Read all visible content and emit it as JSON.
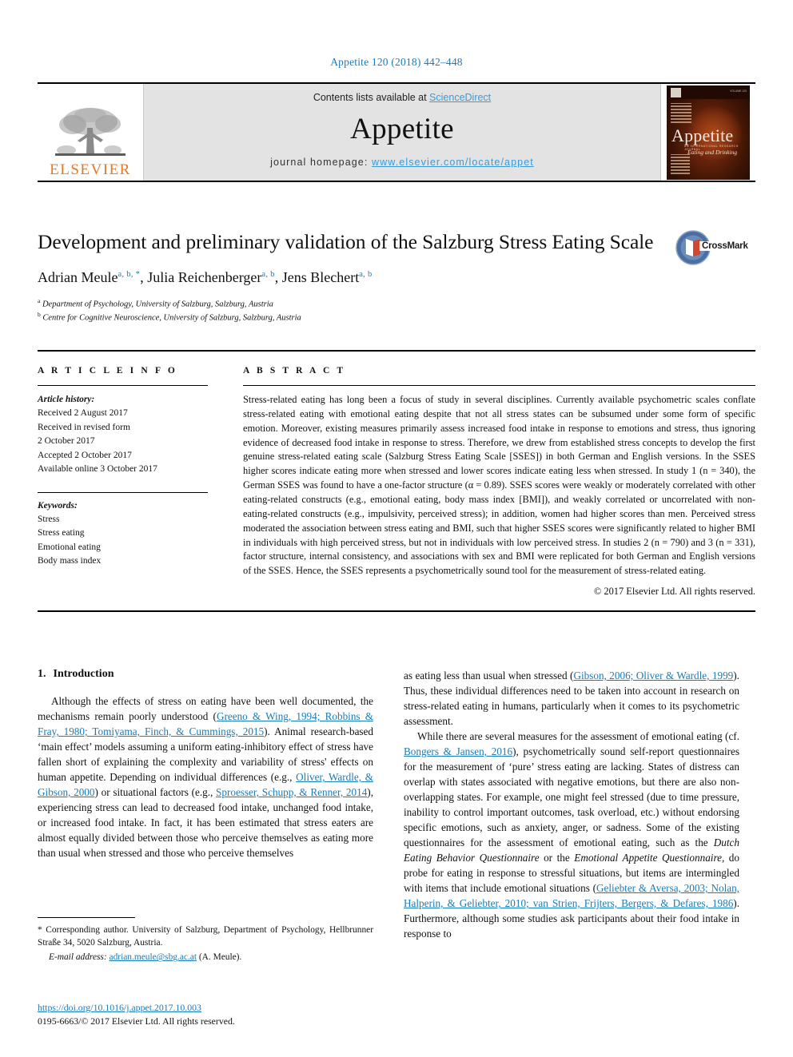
{
  "running_head": "Appetite 120 (2018) 442–448",
  "masthead": {
    "contents_prefix": "Contents lists available at ",
    "sciencedirect": "ScienceDirect",
    "journal_title": "Appetite",
    "homepage_prefix": "journal homepage: ",
    "homepage_url": "www.elsevier.com/locate/appet",
    "publisher_name": "ELSEVIER",
    "publisher_logo_icon": "elsevier-tree-logo",
    "cover": {
      "journal_name": "Appetite",
      "subtitle_small": "AN INTERNATIONAL RESEARCH JOURNAL",
      "subtitle_italic": "Eating and Drinking",
      "issue_text": "VOLUME 120"
    }
  },
  "article": {
    "title": "Development and preliminary validation of the Salzburg Stress Eating Scale",
    "authors": [
      {
        "name": "Adrian Meule",
        "marks": "a, b, *"
      },
      {
        "name": "Julia Reichenberger",
        "marks": "a, b"
      },
      {
        "name": "Jens Blechert",
        "marks": "a, b"
      }
    ],
    "affiliations": [
      {
        "mark": "a",
        "text": "Department of Psychology, University of Salzburg, Salzburg, Austria"
      },
      {
        "mark": "b",
        "text": "Centre for Cognitive Neuroscience, University of Salzburg, Salzburg, Austria"
      }
    ],
    "crossmark_label": "CrossMark",
    "crossmark_icon": "crossmark-badge-icon"
  },
  "article_info": {
    "heading": "A R T I C L E  I N F O",
    "history_label": "Article history:",
    "history_lines": [
      "Received 2 August 2017",
      "Received in revised form",
      "2 October 2017",
      "Accepted 2 October 2017",
      "Available online 3 October 2017"
    ],
    "keywords_label": "Keywords:",
    "keywords": [
      "Stress",
      "Stress eating",
      "Emotional eating",
      "Body mass index"
    ]
  },
  "abstract": {
    "heading": "A B S T R A C T",
    "text": "Stress-related eating has long been a focus of study in several disciplines. Currently available psychometric scales conflate stress-related eating with emotional eating despite that not all stress states can be subsumed under some form of specific emotion. Moreover, existing measures primarily assess increased food intake in response to emotions and stress, thus ignoring evidence of decreased food intake in response to stress. Therefore, we drew from established stress concepts to develop the first genuine stress-related eating scale (Salzburg Stress Eating Scale [SSES]) in both German and English versions. In the SSES higher scores indicate eating more when stressed and lower scores indicate eating less when stressed. In study 1 (n = 340), the German SSES was found to have a one-factor structure (α = 0.89). SSES scores were weakly or moderately correlated with other eating-related constructs (e.g., emotional eating, body mass index [BMI]), and weakly correlated or uncorrelated with non-eating-related constructs (e.g., impulsivity, perceived stress); in addition, women had higher scores than men. Perceived stress moderated the association between stress eating and BMI, such that higher SSES scores were significantly related to higher BMI in individuals with high perceived stress, but not in individuals with low perceived stress. In studies 2 (n = 790) and 3 (n = 331), factor structure, internal consistency, and associations with sex and BMI were replicated for both German and English versions of the SSES. Hence, the SSES represents a psychometrically sound tool for the measurement of stress-related eating.",
    "copyright": "© 2017 Elsevier Ltd. All rights reserved."
  },
  "introduction": {
    "number": "1.",
    "heading": "Introduction",
    "left_paragraph_1_a": "Although the effects of stress on eating have been well documented, the mechanisms remain poorly understood (",
    "left_cite_1": "Greeno & Wing, 1994; Robbins & Fray, 1980; Tomiyama, Finch, & Cummings, 2015",
    "left_paragraph_1_b": "). Animal research-based ‘main effect’ models assuming a uniform eating-inhibitory effect of stress have fallen short of explaining the complexity and variability of stress' effects on human appetite. Depending on individual differences (e.g., ",
    "left_cite_2": "Oliver, Wardle, & Gibson, 2000",
    "left_paragraph_1_c": ") or situational factors (e.g., ",
    "left_cite_3": "Sproesser, Schupp, & Renner, 2014",
    "left_paragraph_1_d": "), experiencing stress can lead to decreased food intake, unchanged food intake, or increased food intake. In fact, it has been estimated that stress eaters are almost equally divided between those who perceive themselves as eating more than usual when stressed and those who perceive themselves",
    "right_paragraph_1_a": "as eating less than usual when stressed (",
    "right_cite_1": "Gibson, 2006; Oliver & Wardle, 1999",
    "right_paragraph_1_b": "). Thus, these individual differences need to be taken into account in research on stress-related eating in humans, particularly when it comes to its psychometric assessment.",
    "right_paragraph_2_a": "While there are several measures for the assessment of emotional eating (cf. ",
    "right_cite_2": "Bongers & Jansen, 2016",
    "right_paragraph_2_b": "), psychometrically sound self-report questionnaires for the measurement of ‘pure’ stress eating are lacking. States of distress can overlap with states associated with negative emotions, but there are also non-overlapping states. For example, one might feel stressed (due to time pressure, inability to control important outcomes, task overload, etc.) without endorsing specific emotions, such as anxiety, anger, or sadness. Some of the existing questionnaires for the assessment of emotional eating, such as the ",
    "right_italic_1": "Dutch Eating Behavior Questionnaire",
    "right_paragraph_2_c": " or the ",
    "right_italic_2": "Emotional Appetite Questionnaire",
    "right_paragraph_2_d": ", do probe for eating in response to stressful situations, but items are intermingled with items that include emotional situations (",
    "right_cite_3": "Geliebter & Aversa, 2003; Nolan, Halperin, & Geliebter, 2010; van Strien, Frijters, Bergers, & Defares, 1986",
    "right_paragraph_2_e": "). Furthermore, although some studies ask participants about their food intake in response to"
  },
  "footer": {
    "corresponding_marker": "*",
    "corresponding_text": " Corresponding author. University of Salzburg, Department of Psychology, Hellbrunner Straße 34, 5020 Salzburg, Austria.",
    "email_label": "E-mail address:",
    "email_address": "adrian.meule@sbg.ac.at",
    "email_suffix": " (A. Meule).",
    "doi": "https://doi.org/10.1016/j.appet.2017.10.003",
    "issn_line": "0195-6663/© 2017 Elsevier Ltd. All rights reserved."
  },
  "colors": {
    "link_blue": "#1a7bb9",
    "sciencedirect_blue": "#3a9bd6",
    "elsevier_orange": "#e87722",
    "masthead_gray": "#e3e3e3"
  }
}
